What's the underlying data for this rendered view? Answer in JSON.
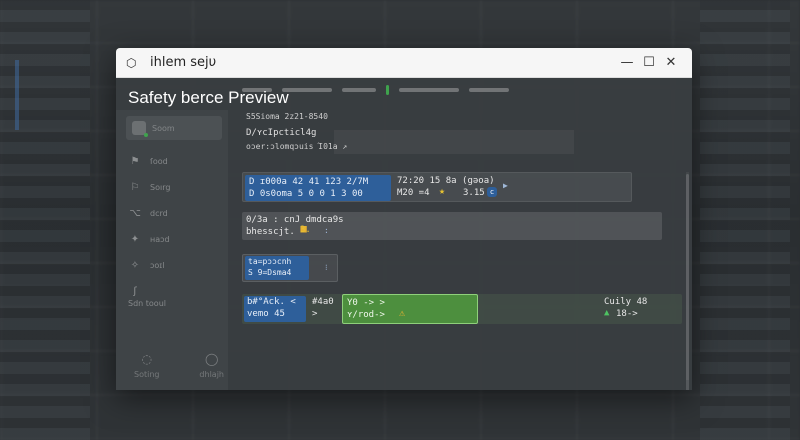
{
  "window": {
    "title": "ihlem ѕejυ",
    "preview_title": "Safety berce Preview",
    "controls": {
      "minimize": "—",
      "maximize": "☐",
      "close": "✕"
    }
  },
  "sidebar": {
    "user": {
      "name": "Ѕoom"
    },
    "items": [
      {
        "label": "ſood",
        "icon": "grid-icon"
      },
      {
        "label": "Ѕoırg",
        "icon": "tag-icon"
      },
      {
        "label": "dcrd",
        "icon": "branch-icon"
      },
      {
        "label": "ʜaɔd",
        "icon": "shield-icon"
      },
      {
        "label": "ɔoɪl",
        "icon": "node-icon"
      },
      {
        "label": "Ѕdn tooul",
        "icon": "hook-icon"
      }
    ],
    "bottom": [
      {
        "label": "Ѕoting",
        "icon": "chat-icon"
      },
      {
        "label": "dhlajh",
        "icon": "chat-bubble-icon"
      }
    ]
  },
  "main": {
    "meta_1": "Ѕ5Ѕioma   2z21-8540",
    "meta_2": "D/ʏcIpcticl4g",
    "meta_3": "oɔer:ɔlomqɔuis  Ί01a ↗",
    "row1": {
      "chip_top": "D ɪ000a   42   41  123  2/7M",
      "chip_bottom": "D 0s0oma  5 0  0 1  3 00",
      "mid_top": "72:20 15 8a (gǝoa)",
      "mid_bottom": "M20 =4",
      "mid_value": "3.15",
      "arrow": "▶"
    },
    "row2": {
      "line1": "0/3a : cnJ dmdca9s",
      "line2": "bhesscjt.",
      "badge": "3.",
      "arrow": ":"
    },
    "row3": {
      "line1": "ta=pɔɔcnh",
      "line2": "Ѕ 9=Dsma4",
      "arrow": "⁝"
    },
    "row4": {
      "left_line1": "b#°Ack.  <",
      "left_line2": "vemo   45",
      "left_tag_1": "#4a0",
      "left_tag_2": ">",
      "green_line1": "Y0 ->  >",
      "green_line2": "ʏ/rod->",
      "right_line1": "Cuily  48",
      "right_line2": "18->"
    }
  },
  "colors": {
    "accent_blue": "#2e5f9a",
    "green": "#4d8f3e",
    "warning": "#e6b132",
    "star": "#e6c232"
  }
}
